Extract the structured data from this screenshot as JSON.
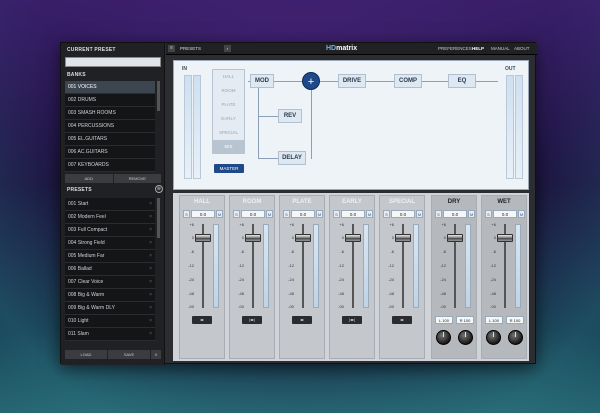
{
  "left": {
    "current_preset_label": "CURRENT PRESET",
    "current_preset_value": "",
    "banks_label": "BANKS",
    "banks": [
      "001 VOICES",
      "002 DRUMS",
      "003 SMASH ROOMS",
      "004 PERCUSSIONS",
      "005 EL.GUITARS",
      "006 AC.GUITARS",
      "007 KEYBOARDS"
    ],
    "bank_add": "ADD",
    "bank_remove": "REMOVE",
    "presets_label": "PRESETS",
    "presets": [
      "001 Start",
      "002 Modern Feel",
      "003 Full Compact",
      "004 Strong Field",
      "005 Medium Far",
      "006 Ballad",
      "007 Clear Voice",
      "008 Big & Warm",
      "009 Big & Warm DLY",
      "010 Light",
      "011 Slam"
    ],
    "load": "LOAD",
    "save": "SAVE",
    "close": "X"
  },
  "topbar": {
    "presets_tab": "PRESETS",
    "logo_prefix": "HD",
    "logo": "matrix",
    "preferences": "PREFERENCES",
    "help": "HELP",
    "manual": "MANUAL",
    "about": "ABOUT"
  },
  "routing": {
    "in": "IN",
    "out": "OUT",
    "mod": "MOD",
    "rev": "REV",
    "delay": "DELAY",
    "drive": "DRIVE",
    "comp": "COMP",
    "eq": "EQ",
    "sum": "+",
    "selector": [
      "HALL",
      "ROOM",
      "PLATE",
      "EARLY",
      "SPECIAL",
      "MIX"
    ],
    "master": "MASTER"
  },
  "mixer": {
    "strips": [
      {
        "name": "HALL",
        "value": "0.0"
      },
      {
        "name": "ROOM",
        "value": "0.0"
      },
      {
        "name": "PLATE",
        "value": "0.0"
      },
      {
        "name": "EARLY",
        "value": "0.0"
      },
      {
        "name": "SPECIAL",
        "value": "0.0"
      },
      {
        "name": "DRY",
        "value": "0.0"
      },
      {
        "name": "WET",
        "value": "0.0"
      }
    ],
    "solo": "S",
    "mute": "M",
    "ticks": [
      "+6",
      "0",
      "-6",
      "-12",
      "-24",
      "-48",
      "-00"
    ],
    "dry_l": "L 100",
    "dry_r": "R 100",
    "wet_l": "L 100",
    "wet_r": "R 100",
    "pan_label": "◂▸"
  }
}
